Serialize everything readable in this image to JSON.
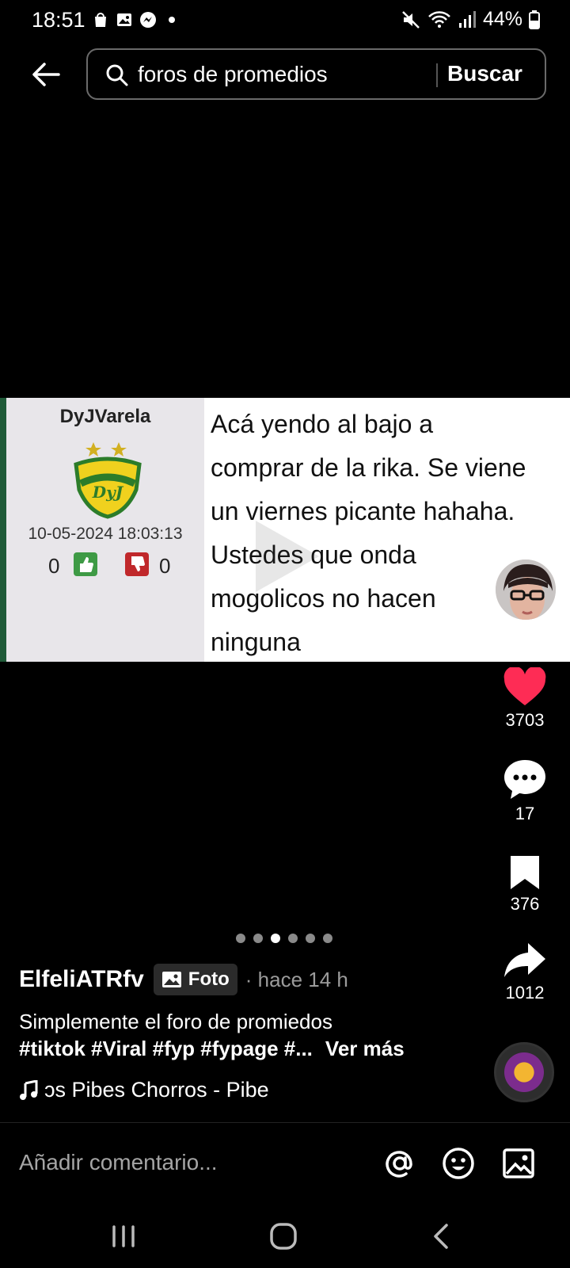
{
  "status_bar": {
    "time": "18:51",
    "battery": "44%"
  },
  "search": {
    "query": "foros de promedios",
    "button_label": "Buscar"
  },
  "post_image": {
    "forum_username": "DyJVarela",
    "badge_text": "DyJ",
    "date": "10-05-2024 18:03:13",
    "upvotes": "0",
    "downvotes": "0",
    "lines": [
      "Acá yendo al bajo a",
      "comprar de la rika. Se viene",
      "un viernes picante hahaha.",
      "Ustedes que onda",
      "mogolicos no hacen",
      "ninguna"
    ]
  },
  "actions": {
    "likes": "3703",
    "comments": "17",
    "saves": "376",
    "shares": "1012"
  },
  "carousel": {
    "total": 6,
    "active_index": 2
  },
  "post_info": {
    "author": "ElfeliATRfv",
    "type_badge": "Foto",
    "time": "· hace 14 h",
    "caption": "Simplemente el foro de promiedos",
    "hashtags": "#tiktok #Viral #fyp #fypage #...",
    "see_more": "Ver más",
    "music": "ɔs Pibes Chorros - Pibe"
  },
  "comment_bar": {
    "placeholder": "Añadir comentario..."
  },
  "colors": {
    "like_red": "#fe2c55",
    "background": "#000000"
  }
}
